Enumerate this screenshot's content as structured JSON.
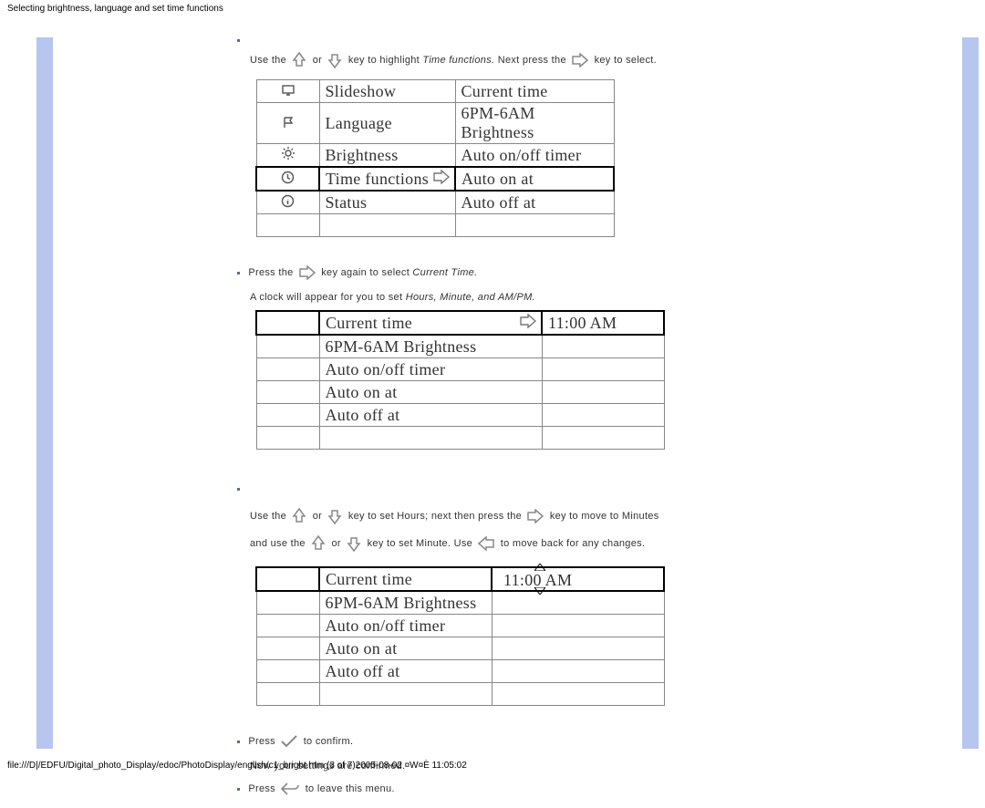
{
  "header_title": "Selecting brightness, language and set time functions",
  "instr1": {
    "part1": "Use the",
    "part2": "or",
    "part3": "key to highlight",
    "term": "Time functions.",
    "part4": "Next press the",
    "part5": "key to select."
  },
  "menu1": {
    "rows": [
      {
        "mid": "Slideshow",
        "right": "Current time",
        "icon": "slideshow"
      },
      {
        "mid": "Language",
        "right": "6PM-6AM Brightness",
        "icon": "flag"
      },
      {
        "mid": "Brightness",
        "right": "Auto on/off timer",
        "icon": "sun"
      },
      {
        "mid": "Time functions",
        "right": "Auto on at",
        "icon": "clock",
        "selected": true,
        "arrow": true
      },
      {
        "mid": "Status",
        "right": "Auto off at",
        "icon": "info"
      }
    ]
  },
  "instr2": {
    "part1": "Press the",
    "part2": "key again to select",
    "term": "Current Time."
  },
  "instr2b": {
    "part1": "A clock will appear for you to set",
    "term": "Hours, Minute, and AM/PM."
  },
  "menu2": {
    "rows": [
      {
        "mid": "Current time",
        "right": "11:00 AM",
        "selected": true,
        "arrow": true
      },
      {
        "mid": "6PM-6AM Brightness",
        "right": ""
      },
      {
        "mid": "Auto on/off timer",
        "right": ""
      },
      {
        "mid": "Auto on at",
        "right": ""
      },
      {
        "mid": "Auto off at",
        "right": ""
      }
    ]
  },
  "instr3": {
    "line1_a": "Use the",
    "line1_b": "or",
    "line1_c": "key to set Hours; next then press the",
    "line1_d": "key to move to Minutes",
    "line2_a": "and use the",
    "line2_b": "or",
    "line2_c": "key to set Minute. Use",
    "line2_d": "to move back for any changes."
  },
  "menu3": {
    "rows": [
      {
        "mid": "Current time",
        "right": "11:00 AM",
        "selected": true,
        "editing": true
      },
      {
        "mid": "6PM-6AM Brightness",
        "right": ""
      },
      {
        "mid": "Auto on/off timer",
        "right": ""
      },
      {
        "mid": "Auto on at",
        "right": ""
      },
      {
        "mid": "Auto off at",
        "right": ""
      }
    ]
  },
  "instr4": {
    "part1": "Press",
    "part2": "to confirm."
  },
  "instr4b": "Now your settings are confirmed.",
  "instr5": {
    "part1": "Press",
    "part2": "to leave this menu."
  },
  "footer": "file:///D|/EDFU/Digital_photo_Display/edoc/PhotoDisplay/english/c1_bright.htm (3 of 7)2005-08-02 ¤W¤È 11:05:02"
}
